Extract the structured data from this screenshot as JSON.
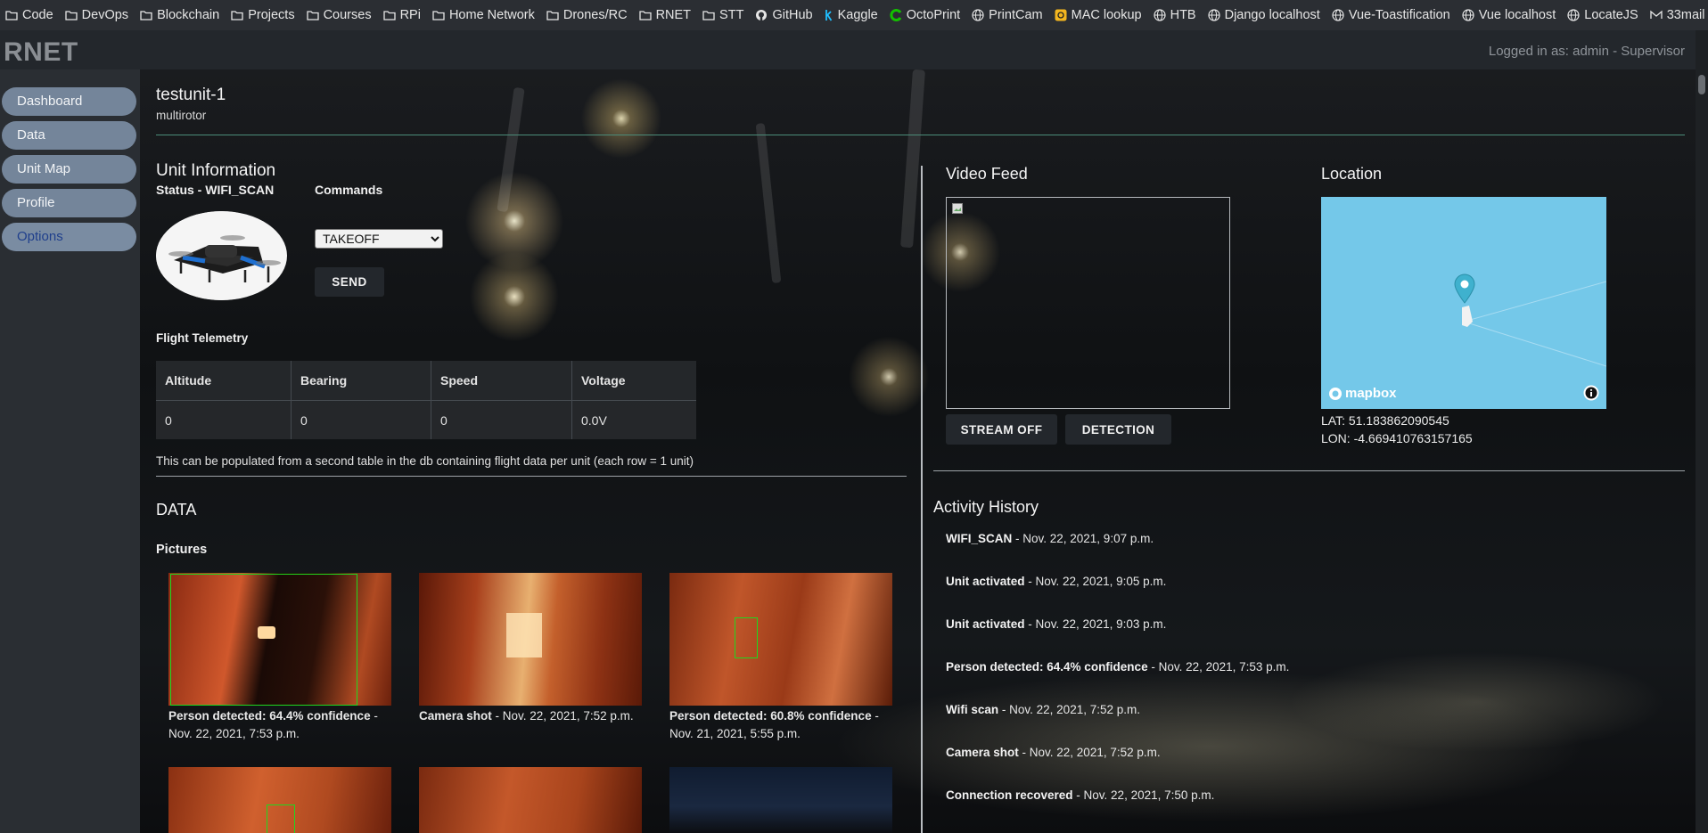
{
  "bookmarks": [
    {
      "label": "Code",
      "icon": "folder-icon"
    },
    {
      "label": "DevOps",
      "icon": "folder-icon"
    },
    {
      "label": "Blockchain",
      "icon": "folder-icon"
    },
    {
      "label": "Projects",
      "icon": "folder-icon"
    },
    {
      "label": "Courses",
      "icon": "folder-icon"
    },
    {
      "label": "RPi",
      "icon": "folder-icon"
    },
    {
      "label": "Home Network",
      "icon": "folder-icon"
    },
    {
      "label": "Drones/RC",
      "icon": "folder-icon"
    },
    {
      "label": "RNET",
      "icon": "folder-icon"
    },
    {
      "label": "STT",
      "icon": "folder-icon"
    },
    {
      "label": "GitHub",
      "icon": "github-icon"
    },
    {
      "label": "Kaggle",
      "icon": "kaggle-icon"
    },
    {
      "label": "OctoPrint",
      "icon": "octoprint-icon"
    },
    {
      "label": "PrintCam",
      "icon": "globe-icon"
    },
    {
      "label": "MAC lookup",
      "icon": "mac-lookup-icon"
    },
    {
      "label": "HTB",
      "icon": "globe-icon"
    },
    {
      "label": "Django localhost",
      "icon": "globe-icon"
    },
    {
      "label": "Vue-Toastification",
      "icon": "globe-icon"
    },
    {
      "label": "Vue localhost",
      "icon": "globe-icon"
    },
    {
      "label": "LocateJS",
      "icon": "globe-icon"
    },
    {
      "label": "33mail",
      "icon": "mail-icon"
    }
  ],
  "app": {
    "brand": "RNET",
    "login_status": "Logged in as: admin - Supervisor"
  },
  "sidebar": {
    "items": [
      {
        "label": "Dashboard"
      },
      {
        "label": "Data"
      },
      {
        "label": "Unit Map"
      },
      {
        "label": "Profile"
      },
      {
        "label": "Options",
        "active": true
      }
    ]
  },
  "unit": {
    "name": "testunit-1",
    "type": "multirotor"
  },
  "unit_info": {
    "heading": "Unit Information",
    "status": "Status - WIFI_SCAN",
    "commands_heading": "Commands",
    "command_selected": "TAKEOFF",
    "send_label": "SEND"
  },
  "telemetry": {
    "heading": "Flight Telemetry",
    "columns": [
      "Altitude",
      "Bearing",
      "Speed",
      "Voltage"
    ],
    "values": [
      "0",
      "0",
      "0",
      "0.0V"
    ],
    "note": "This can be populated from a second table in the db containing flight data per unit (each row = 1 unit)"
  },
  "data_section": {
    "heading": "DATA",
    "pictures_heading": "Pictures",
    "pictures": [
      {
        "title": "Person detected: 64.4% confidence",
        "date": "Nov. 22, 2021, 7:53 p.m."
      },
      {
        "title": "Camera shot",
        "date": "Nov. 22, 2021, 7:52 p.m."
      },
      {
        "title": "Person detected: 60.8% confidence",
        "date": "Nov. 21, 2021, 5:55 p.m."
      }
    ]
  },
  "video": {
    "heading": "Video Feed",
    "stream_label": "STREAM OFF",
    "detection_label": "DETECTION"
  },
  "location": {
    "heading": "Location",
    "map_logo": "mapbox",
    "lat": "LAT: 51.183862090545",
    "lon": "LON: -4.669410763157165"
  },
  "activity": {
    "heading": "Activity History",
    "items": [
      {
        "event": "WIFI_SCAN",
        "date": " - Nov. 22, 2021, 9:07 p.m."
      },
      {
        "event": "Unit activated",
        "date": " - Nov. 22, 2021, 9:05 p.m."
      },
      {
        "event": "Unit activated",
        "date": " - Nov. 22, 2021, 9:03 p.m."
      },
      {
        "event": "Person detected: 64.4% confidence",
        "date": " - Nov. 22, 2021, 7:53 p.m."
      },
      {
        "event": "Wifi scan",
        "date": " - Nov. 22, 2021, 7:52 p.m."
      },
      {
        "event": "Camera shot",
        "date": " - Nov. 22, 2021, 7:52 p.m."
      },
      {
        "event": "Connection recovered",
        "date": " - Nov. 22, 2021, 7:50 p.m."
      }
    ]
  },
  "colors": {
    "accent_rule": "#4c8c79",
    "nav_button": "#74859a",
    "map_water": "#74c8e9"
  }
}
